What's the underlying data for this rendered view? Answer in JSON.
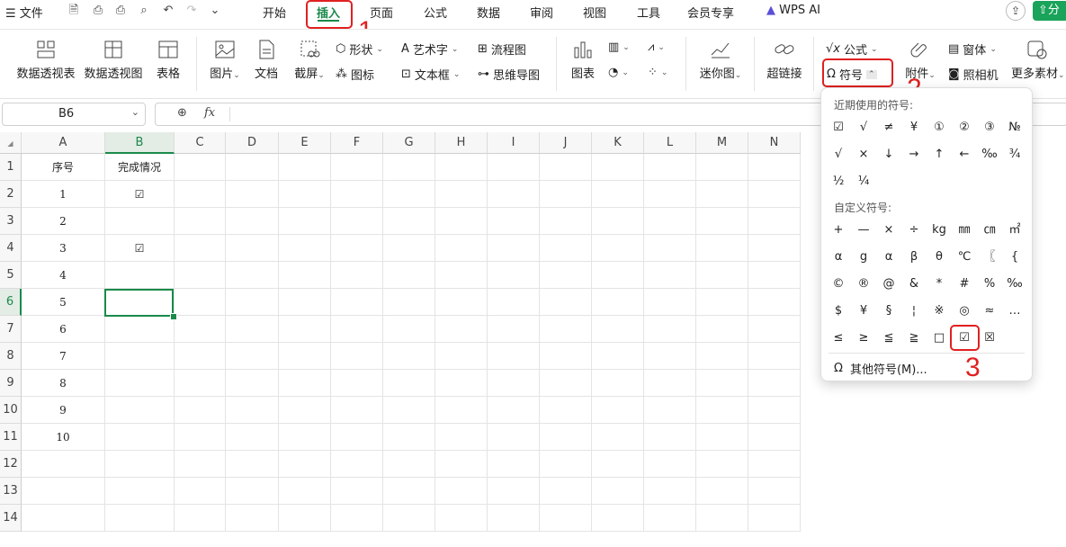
{
  "menubar": {
    "file": "文件",
    "tabs": [
      "开始",
      "插入",
      "页面",
      "公式",
      "数据",
      "审阅",
      "视图",
      "工具",
      "会员专享",
      "WPS AI"
    ],
    "share": "分"
  },
  "ribbon": {
    "pivot_table": "数据透视表",
    "pivot_chart": "数据透视图",
    "table": "表格",
    "picture": "图片",
    "document": "文档",
    "screenshot": "截屏",
    "shapes": "形状",
    "icons": "图标",
    "wordart": "艺术字",
    "textbox": "文本框",
    "flowchart": "流程图",
    "mindmap": "思维导图",
    "chart": "图表",
    "sparkline": "迷你图",
    "hyperlink": "超链接",
    "formula": "公式",
    "symbol": "符号",
    "attachment": "附件",
    "window": "窗体",
    "camera": "照相机",
    "more": "更多素材"
  },
  "formula_bar": {
    "cell_ref": "B6",
    "fx": "fx",
    "value": ""
  },
  "grid": {
    "columns": [
      "A",
      "B",
      "C",
      "D",
      "E",
      "F",
      "G",
      "H",
      "I",
      "J",
      "K",
      "L",
      "M",
      "N"
    ],
    "rows": [
      "1",
      "2",
      "3",
      "4",
      "5",
      "6",
      "7",
      "8",
      "9",
      "10",
      "11",
      "12",
      "13",
      "14"
    ],
    "header_row": {
      "a": "序号",
      "b": "完成情况"
    },
    "data": [
      {
        "a": "1",
        "b": "☑"
      },
      {
        "a": "2",
        "b": ""
      },
      {
        "a": "3",
        "b": "☑"
      },
      {
        "a": "4",
        "b": ""
      },
      {
        "a": "5",
        "b": ""
      },
      {
        "a": "6",
        "b": ""
      },
      {
        "a": "7",
        "b": ""
      },
      {
        "a": "8",
        "b": ""
      },
      {
        "a": "9",
        "b": ""
      },
      {
        "a": "10",
        "b": ""
      }
    ],
    "selected_cell": "B6"
  },
  "symbol_popup": {
    "recent_title": "近期使用的符号:",
    "recent": [
      "☑",
      "√",
      "≠",
      "¥",
      "①",
      "②",
      "③",
      "№",
      "√",
      "×",
      "↓",
      "→",
      "↑",
      "←",
      "‰",
      "¾",
      "½",
      "¼"
    ],
    "custom_title": "自定义符号:",
    "custom": [
      "+",
      "—",
      "×",
      "÷",
      "kg",
      "㎜",
      "㎝",
      "㎡",
      "α",
      "g",
      "α",
      "β",
      "θ",
      "℃",
      "〖",
      "{",
      "©",
      "®",
      "@",
      "&",
      "*",
      "#",
      "%",
      "‰",
      "$",
      "¥",
      "§",
      "¦",
      "※",
      "◎",
      "≈",
      "…",
      "≤",
      "≥",
      "≦",
      "≧",
      "□",
      "☑",
      "☒"
    ],
    "more": "其他符号(M)..."
  },
  "annotations": {
    "step1": "1",
    "step2": "2",
    "step3": "3"
  }
}
